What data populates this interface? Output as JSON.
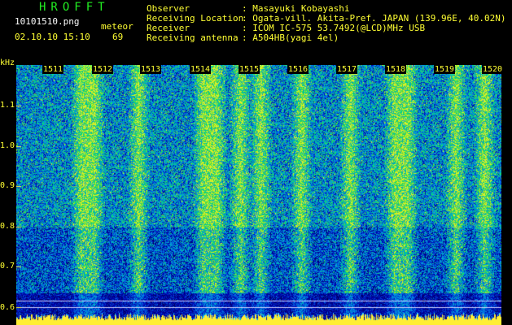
{
  "header": {
    "logo": "HROFFT",
    "filename": "10101510.png",
    "datetime": "02.10.10 15:10",
    "meteor_label": "meteor",
    "meteor_count": "69"
  },
  "meta": [
    {
      "label": "Observer",
      "value": ": Masayuki Kobayashi"
    },
    {
      "label": "Receiving Location",
      "value": ": Ogata-vill. Akita-Pref. JAPAN (139.96E, 40.02N)"
    },
    {
      "label": "Receiver",
      "value": ": ICOM IC-575 53.7492(@LCD)MHz USB"
    },
    {
      "label": "Receiving antenna",
      "value": ": A504HB(yagi 4el)"
    }
  ],
  "axis": {
    "unit": "kHz",
    "ticks": [
      "1.1",
      "1.0",
      "0.9",
      "0.8",
      "0.7",
      "0.6"
    ]
  },
  "minutes": [
    "1511",
    "1512",
    "1513",
    "1514",
    "1515",
    "1516",
    "1517",
    "1518",
    "1519",
    "1520"
  ],
  "colors": {
    "text_yellow": "#ffff33",
    "logo_green": "#22ee22",
    "background": "#000000"
  }
}
